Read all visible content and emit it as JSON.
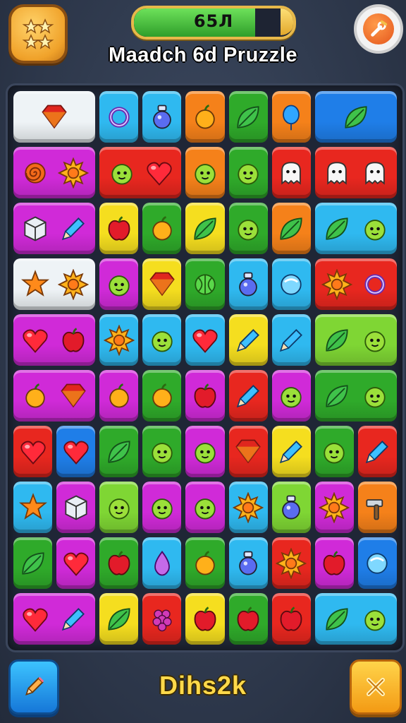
{
  "header": {
    "score_text": "65Л",
    "score_progress": 0.76,
    "title": "Maadch 6d Pruzzle"
  },
  "footer": {
    "label": "Dihs2k"
  },
  "colors": {
    "red": "#e8271f",
    "orange": "#f5811a",
    "yellow": "#f5de1f",
    "green": "#2faa2a",
    "lime": "#7fd634",
    "cyan": "#2fb9f0",
    "blue": "#1f7ee8",
    "purple": "#9a33e0",
    "magenta": "#d02ad8",
    "white": "#eef3f6"
  },
  "board": {
    "columns": 9,
    "rows": 10,
    "tiles": [
      {
        "row": 0,
        "col": 0,
        "span": 2,
        "color": "white",
        "icons": [
          "gem-icon"
        ]
      },
      {
        "row": 0,
        "col": 2,
        "span": 1,
        "color": "cyan",
        "icons": [
          "ring-icon"
        ]
      },
      {
        "row": 0,
        "col": 3,
        "span": 1,
        "color": "cyan",
        "icons": [
          "potion-icon"
        ]
      },
      {
        "row": 0,
        "col": 4,
        "span": 1,
        "color": "orange",
        "icons": [
          "fruit-icon"
        ]
      },
      {
        "row": 0,
        "col": 5,
        "span": 1,
        "color": "green",
        "icons": [
          "leaf-icon"
        ]
      },
      {
        "row": 0,
        "col": 6,
        "span": 1,
        "color": "orange",
        "icons": [
          "balloon-icon"
        ]
      },
      {
        "row": 0,
        "col": 7,
        "span": 2,
        "color": "blue",
        "icons": [
          "leaf-icon"
        ]
      },
      {
        "row": 1,
        "col": 0,
        "span": 2,
        "color": "magenta",
        "icons": [
          "swirl-icon",
          "sun-icon"
        ]
      },
      {
        "row": 1,
        "col": 2,
        "span": 2,
        "color": "red",
        "icons": [
          "blob-icon",
          "heart-icon"
        ]
      },
      {
        "row": 1,
        "col": 4,
        "span": 1,
        "color": "orange",
        "icons": [
          "blob-icon"
        ]
      },
      {
        "row": 1,
        "col": 5,
        "span": 1,
        "color": "green",
        "icons": [
          "blob-icon"
        ]
      },
      {
        "row": 1,
        "col": 6,
        "span": 1,
        "color": "red",
        "icons": [
          "ghost-icon"
        ]
      },
      {
        "row": 1,
        "col": 7,
        "span": 2,
        "color": "red",
        "icons": [
          "ghost-icon",
          "ghost-icon"
        ]
      },
      {
        "row": 2,
        "col": 0,
        "span": 2,
        "color": "magenta",
        "icons": [
          "cube-icon",
          "pencil-icon"
        ]
      },
      {
        "row": 2,
        "col": 2,
        "span": 1,
        "color": "yellow",
        "icons": [
          "apple-icon"
        ]
      },
      {
        "row": 2,
        "col": 3,
        "span": 1,
        "color": "green",
        "icons": [
          "fruit-icon"
        ]
      },
      {
        "row": 2,
        "col": 4,
        "span": 1,
        "color": "yellow",
        "icons": [
          "leaf-icon"
        ]
      },
      {
        "row": 2,
        "col": 5,
        "span": 1,
        "color": "green",
        "icons": [
          "blob-icon"
        ]
      },
      {
        "row": 2,
        "col": 6,
        "span": 1,
        "color": "orange",
        "icons": [
          "leaf-icon"
        ]
      },
      {
        "row": 2,
        "col": 7,
        "span": 2,
        "color": "cyan",
        "icons": [
          "leaf-icon",
          "blob-icon"
        ]
      },
      {
        "row": 3,
        "col": 0,
        "span": 2,
        "color": "white",
        "icons": [
          "star-icon",
          "sun-icon"
        ]
      },
      {
        "row": 3,
        "col": 2,
        "span": 1,
        "color": "magenta",
        "icons": [
          "blob-icon"
        ]
      },
      {
        "row": 3,
        "col": 3,
        "span": 1,
        "color": "yellow",
        "icons": [
          "gem-icon"
        ]
      },
      {
        "row": 3,
        "col": 4,
        "span": 1,
        "color": "green",
        "icons": [
          "melon-icon"
        ]
      },
      {
        "row": 3,
        "col": 5,
        "span": 1,
        "color": "cyan",
        "icons": [
          "potion-icon"
        ]
      },
      {
        "row": 3,
        "col": 6,
        "span": 1,
        "color": "cyan",
        "icons": [
          "orb-icon"
        ]
      },
      {
        "row": 3,
        "col": 7,
        "span": 2,
        "color": "red",
        "icons": [
          "sun-icon",
          "ring-icon"
        ]
      },
      {
        "row": 4,
        "col": 0,
        "span": 2,
        "color": "magenta",
        "icons": [
          "heart-icon",
          "apple-icon"
        ]
      },
      {
        "row": 4,
        "col": 2,
        "span": 1,
        "color": "cyan",
        "icons": [
          "sun-icon"
        ]
      },
      {
        "row": 4,
        "col": 3,
        "span": 1,
        "color": "cyan",
        "icons": [
          "blob-icon"
        ]
      },
      {
        "row": 4,
        "col": 4,
        "span": 1,
        "color": "cyan",
        "icons": [
          "heart-icon"
        ]
      },
      {
        "row": 4,
        "col": 5,
        "span": 1,
        "color": "yellow",
        "icons": [
          "pencil-icon"
        ]
      },
      {
        "row": 4,
        "col": 6,
        "span": 1,
        "color": "cyan",
        "icons": [
          "pencil-icon"
        ]
      },
      {
        "row": 4,
        "col": 7,
        "span": 2,
        "color": "lime",
        "icons": [
          "leaf-icon",
          "blob-icon"
        ]
      },
      {
        "row": 5,
        "col": 0,
        "span": 2,
        "color": "magenta",
        "icons": [
          "fruit-icon",
          "gem-icon"
        ]
      },
      {
        "row": 5,
        "col": 2,
        "span": 1,
        "color": "magenta",
        "icons": [
          "fruit-icon"
        ]
      },
      {
        "row": 5,
        "col": 3,
        "span": 1,
        "color": "green",
        "icons": [
          "fruit-icon"
        ]
      },
      {
        "row": 5,
        "col": 4,
        "span": 1,
        "color": "magenta",
        "icons": [
          "apple-icon"
        ]
      },
      {
        "row": 5,
        "col": 5,
        "span": 1,
        "color": "red",
        "icons": [
          "pencil-icon"
        ]
      },
      {
        "row": 5,
        "col": 6,
        "span": 1,
        "color": "magenta",
        "icons": [
          "blob-icon"
        ]
      },
      {
        "row": 5,
        "col": 7,
        "span": 2,
        "color": "green",
        "icons": [
          "leaf-icon",
          "blob-icon"
        ]
      },
      {
        "row": 6,
        "col": 0,
        "span": 1,
        "color": "red",
        "icons": [
          "heart-icon"
        ]
      },
      {
        "row": 6,
        "col": 1,
        "span": 1,
        "color": "blue",
        "icons": [
          "heart-icon"
        ]
      },
      {
        "row": 6,
        "col": 2,
        "span": 1,
        "color": "green",
        "icons": [
          "leaf-icon"
        ]
      },
      {
        "row": 6,
        "col": 3,
        "span": 1,
        "color": "green",
        "icons": [
          "blob-icon"
        ]
      },
      {
        "row": 6,
        "col": 4,
        "span": 1,
        "color": "magenta",
        "icons": [
          "blob-icon"
        ]
      },
      {
        "row": 6,
        "col": 5,
        "span": 1,
        "color": "red",
        "icons": [
          "gem-icon"
        ]
      },
      {
        "row": 6,
        "col": 6,
        "span": 1,
        "color": "yellow",
        "icons": [
          "pencil-icon"
        ]
      },
      {
        "row": 6,
        "col": 7,
        "span": 1,
        "color": "green",
        "icons": [
          "blob-icon"
        ]
      },
      {
        "row": 6,
        "col": 8,
        "span": 1,
        "color": "red",
        "icons": [
          "pencil-icon"
        ]
      },
      {
        "row": 7,
        "col": 0,
        "span": 1,
        "color": "cyan",
        "icons": [
          "star-icon"
        ]
      },
      {
        "row": 7,
        "col": 1,
        "span": 1,
        "color": "magenta",
        "icons": [
          "cube-icon"
        ]
      },
      {
        "row": 7,
        "col": 2,
        "span": 1,
        "color": "lime",
        "icons": [
          "blob-icon"
        ]
      },
      {
        "row": 7,
        "col": 3,
        "span": 1,
        "color": "magenta",
        "icons": [
          "blob-icon"
        ]
      },
      {
        "row": 7,
        "col": 4,
        "span": 1,
        "color": "magenta",
        "icons": [
          "blob-icon"
        ]
      },
      {
        "row": 7,
        "col": 5,
        "span": 1,
        "color": "cyan",
        "icons": [
          "sun-icon"
        ]
      },
      {
        "row": 7,
        "col": 6,
        "span": 1,
        "color": "lime",
        "icons": [
          "potion-icon"
        ]
      },
      {
        "row": 7,
        "col": 7,
        "span": 1,
        "color": "magenta",
        "icons": [
          "sun-icon"
        ]
      },
      {
        "row": 7,
        "col": 8,
        "span": 1,
        "color": "orange",
        "icons": [
          "hammer-icon"
        ]
      },
      {
        "row": 8,
        "col": 0,
        "span": 1,
        "color": "green",
        "icons": [
          "leaf-icon"
        ]
      },
      {
        "row": 8,
        "col": 1,
        "span": 1,
        "color": "magenta",
        "icons": [
          "heart-icon"
        ]
      },
      {
        "row": 8,
        "col": 2,
        "span": 1,
        "color": "green",
        "icons": [
          "apple-icon"
        ]
      },
      {
        "row": 8,
        "col": 3,
        "span": 1,
        "color": "cyan",
        "icons": [
          "drop-icon"
        ]
      },
      {
        "row": 8,
        "col": 4,
        "span": 1,
        "color": "green",
        "icons": [
          "fruit-icon"
        ]
      },
      {
        "row": 8,
        "col": 5,
        "span": 1,
        "color": "cyan",
        "icons": [
          "potion-icon"
        ]
      },
      {
        "row": 8,
        "col": 6,
        "span": 1,
        "color": "red",
        "icons": [
          "sun-icon"
        ]
      },
      {
        "row": 8,
        "col": 7,
        "span": 1,
        "color": "magenta",
        "icons": [
          "apple-icon"
        ]
      },
      {
        "row": 8,
        "col": 8,
        "span": 1,
        "color": "blue",
        "icons": [
          "orb-icon"
        ]
      },
      {
        "row": 9,
        "col": 0,
        "span": 2,
        "color": "magenta",
        "icons": [
          "heart-icon",
          "pencil-icon"
        ]
      },
      {
        "row": 9,
        "col": 2,
        "span": 1,
        "color": "yellow",
        "icons": [
          "leaf-icon"
        ]
      },
      {
        "row": 9,
        "col": 3,
        "span": 1,
        "color": "red",
        "icons": [
          "grape-icon"
        ]
      },
      {
        "row": 9,
        "col": 4,
        "span": 1,
        "color": "yellow",
        "icons": [
          "apple-icon"
        ]
      },
      {
        "row": 9,
        "col": 5,
        "span": 1,
        "color": "green",
        "icons": [
          "apple-icon"
        ]
      },
      {
        "row": 9,
        "col": 6,
        "span": 1,
        "color": "red",
        "icons": [
          "apple-icon"
        ]
      },
      {
        "row": 9,
        "col": 7,
        "span": 2,
        "color": "cyan",
        "icons": [
          "leaf-icon",
          "blob-icon"
        ]
      }
    ]
  }
}
